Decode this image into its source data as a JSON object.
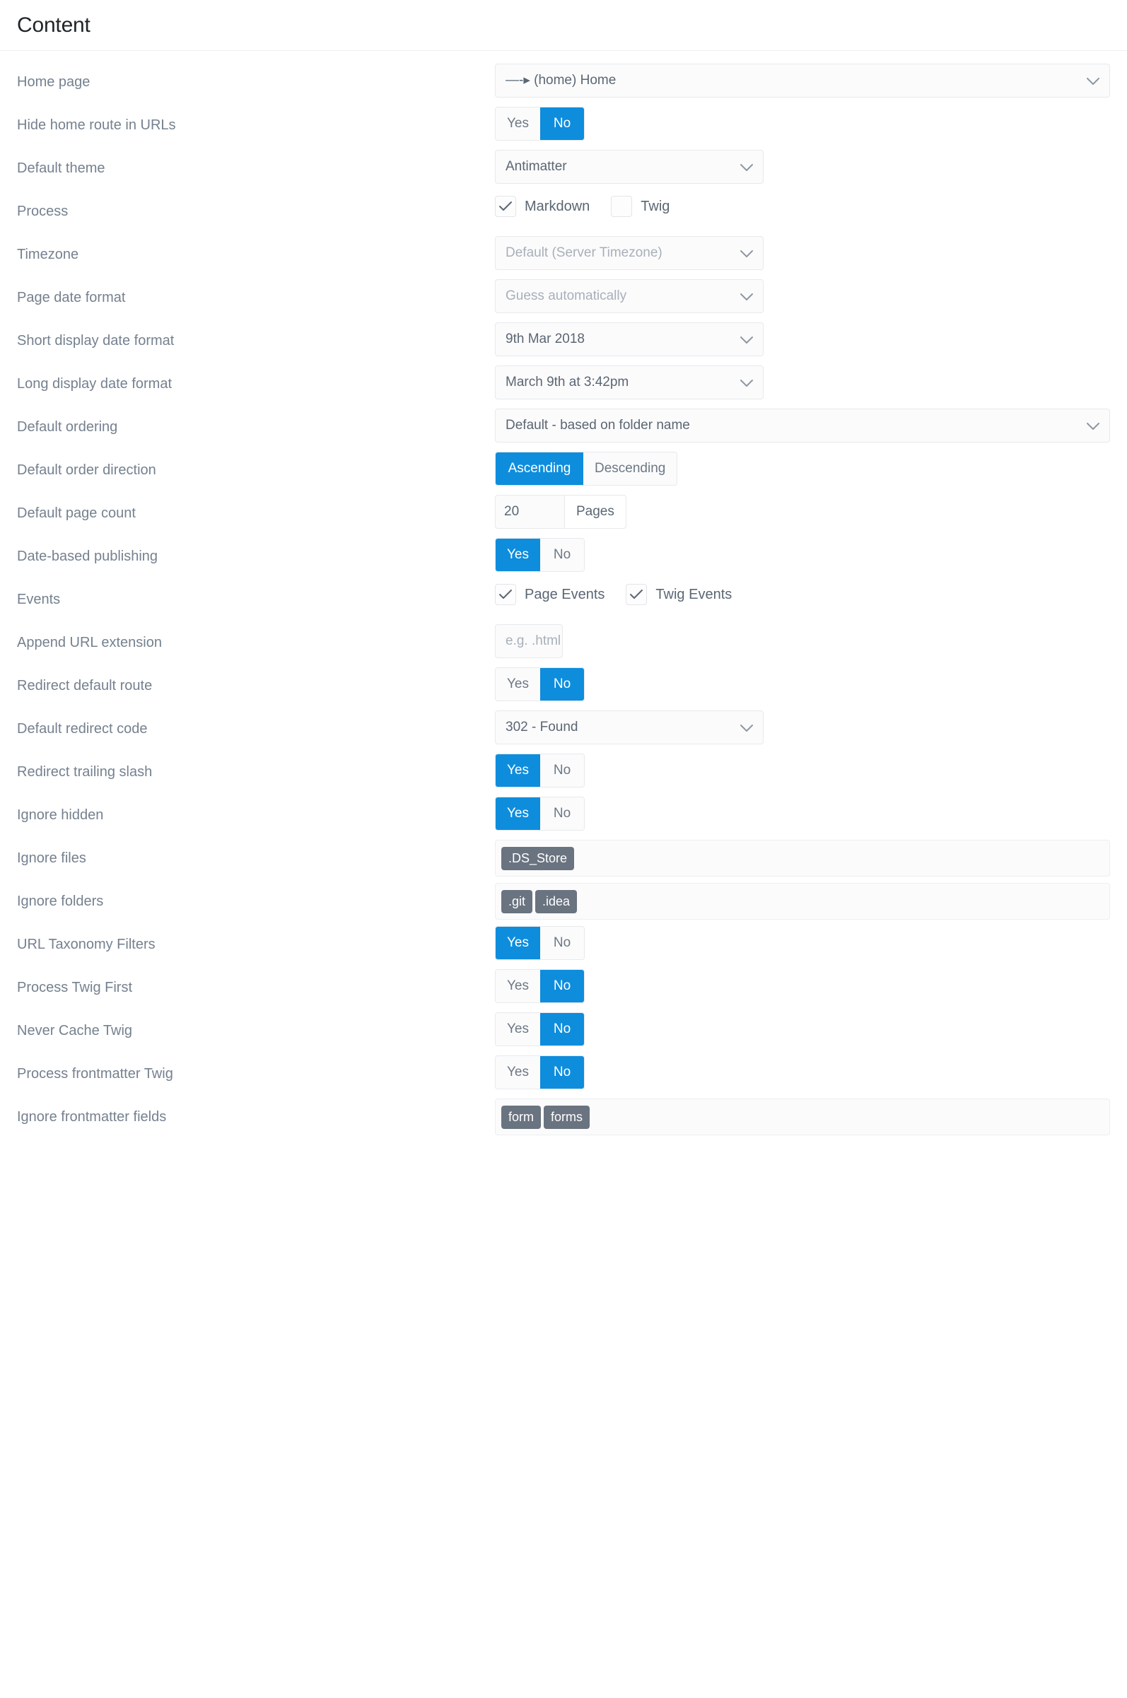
{
  "header": {
    "title": "Content"
  },
  "colors": {
    "accent": "#0e8ddd",
    "label": "#75818f",
    "value": "#5b6673",
    "placeholder": "#a8b0b9",
    "tag_bg": "#6a7380",
    "border": "#e7e9eb"
  },
  "toggle_options": {
    "yes": "Yes",
    "no": "No"
  },
  "rows": [
    {
      "label": "Home page",
      "type": "select",
      "width": "wide",
      "value": "—-▸ (home) Home",
      "muted": false
    },
    {
      "label": "Hide home route in URLs",
      "type": "toggle",
      "options": [
        "Yes",
        "No"
      ],
      "selected": "No"
    },
    {
      "label": "Default theme",
      "type": "select",
      "width": "mid",
      "value": "Antimatter",
      "muted": false
    },
    {
      "label": "Process",
      "type": "checkboxes",
      "items": [
        {
          "label": "Markdown",
          "checked": true
        },
        {
          "label": "Twig",
          "checked": false
        }
      ]
    },
    {
      "label": "Timezone",
      "type": "select",
      "width": "mid",
      "value": "Default (Server Timezone)",
      "muted": true
    },
    {
      "label": "Page date format",
      "type": "select",
      "width": "mid",
      "value": "Guess automatically",
      "muted": true
    },
    {
      "label": "Short display date format",
      "type": "select",
      "width": "mid",
      "value": "9th Mar 2018",
      "muted": false
    },
    {
      "label": "Long display date format",
      "type": "select",
      "width": "mid",
      "value": "March 9th at 3:42pm",
      "muted": false
    },
    {
      "label": "Default ordering",
      "type": "select",
      "width": "wide",
      "value": "Default - based on folder name",
      "muted": false
    },
    {
      "label": "Default order direction",
      "type": "toggle",
      "wide": true,
      "options": [
        "Ascending",
        "Descending"
      ],
      "selected": "Ascending"
    },
    {
      "label": "Default page count",
      "type": "number",
      "value": "20",
      "suffix": "Pages"
    },
    {
      "label": "Date-based publishing",
      "type": "toggle",
      "options": [
        "Yes",
        "No"
      ],
      "selected": "Yes"
    },
    {
      "label": "Events",
      "type": "checkboxes",
      "items": [
        {
          "label": "Page Events",
          "checked": true
        },
        {
          "label": "Twig Events",
          "checked": true
        }
      ]
    },
    {
      "label": "Append URL extension",
      "type": "text",
      "value": "",
      "placeholder": "e.g. .html"
    },
    {
      "label": "Redirect default route",
      "type": "toggle",
      "options": [
        "Yes",
        "No"
      ],
      "selected": "No"
    },
    {
      "label": "Default redirect code",
      "type": "select",
      "width": "mid",
      "value": "302 - Found",
      "muted": false
    },
    {
      "label": "Redirect trailing slash",
      "type": "toggle",
      "options": [
        "Yes",
        "No"
      ],
      "selected": "Yes"
    },
    {
      "label": "Ignore hidden",
      "type": "toggle",
      "options": [
        "Yes",
        "No"
      ],
      "selected": "Yes"
    },
    {
      "label": "Ignore files",
      "type": "tags",
      "tags": [
        ".DS_Store"
      ]
    },
    {
      "label": "Ignore folders",
      "type": "tags",
      "tags": [
        ".git",
        ".idea"
      ]
    },
    {
      "label": "URL Taxonomy Filters",
      "type": "toggle",
      "options": [
        "Yes",
        "No"
      ],
      "selected": "Yes"
    },
    {
      "label": "Process Twig First",
      "type": "toggle",
      "options": [
        "Yes",
        "No"
      ],
      "selected": "No"
    },
    {
      "label": "Never Cache Twig",
      "type": "toggle",
      "options": [
        "Yes",
        "No"
      ],
      "selected": "No"
    },
    {
      "label": "Process frontmatter Twig",
      "type": "toggle",
      "options": [
        "Yes",
        "No"
      ],
      "selected": "No"
    },
    {
      "label": "Ignore frontmatter fields",
      "type": "tags",
      "tags": [
        "form",
        "forms"
      ]
    }
  ]
}
